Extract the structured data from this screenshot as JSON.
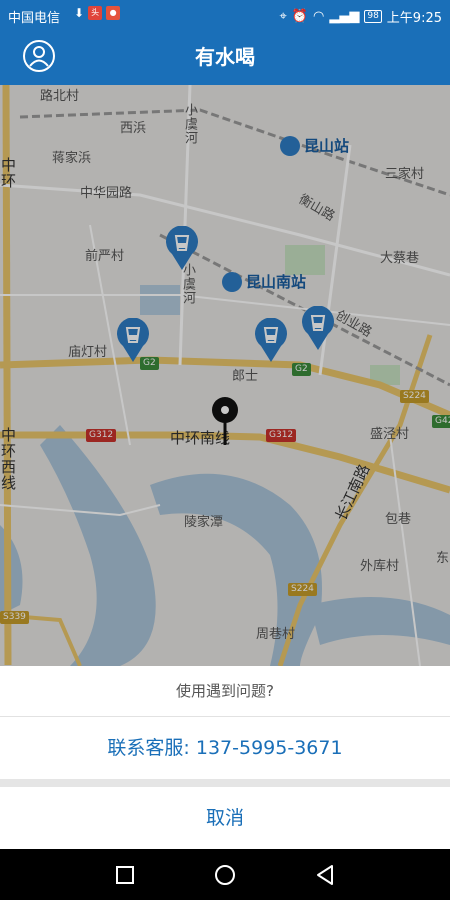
{
  "status_bar": {
    "carrier": "中国电信",
    "battery": "98",
    "time": "上午9:25",
    "icons": [
      "download-icon",
      "app-notification-icon",
      "location-notification-icon",
      "location-icon",
      "alarm-icon",
      "wifi-icon",
      "signal-icon",
      "battery-icon"
    ]
  },
  "header": {
    "title": "有水喝",
    "user_icon": "user-icon"
  },
  "map": {
    "stations": [
      "昆山站",
      "昆山南站"
    ],
    "places": [
      "路北村",
      "西浜",
      "蒋家浜",
      "中华园路",
      "前严村",
      "庙灯村",
      "三家村",
      "衡山路",
      "大蔡巷",
      "创业路",
      "郎士",
      "盛泾村",
      "陵家潭",
      "包巷",
      "外库村",
      "周巷村",
      "中环南线",
      "长江南路",
      "东"
    ],
    "rivers": [
      "小虞河",
      "小虞河"
    ],
    "vertical_roads": [
      "中环",
      "中环西线"
    ],
    "road_shields": [
      "G2",
      "G2",
      "G312",
      "G312",
      "S224",
      "S224",
      "G42",
      "S339"
    ],
    "markers": [
      "water-station-marker",
      "water-station-marker",
      "water-station-marker",
      "water-station-marker",
      "current-location-marker"
    ]
  },
  "sheet": {
    "prompt": "使用遇到问题?",
    "contact": "联系客服: 137-5995-3671",
    "cancel": "取消"
  },
  "nav_bar": {
    "buttons": [
      "recents-square-icon",
      "home-circle-icon",
      "back-triangle-icon"
    ]
  }
}
